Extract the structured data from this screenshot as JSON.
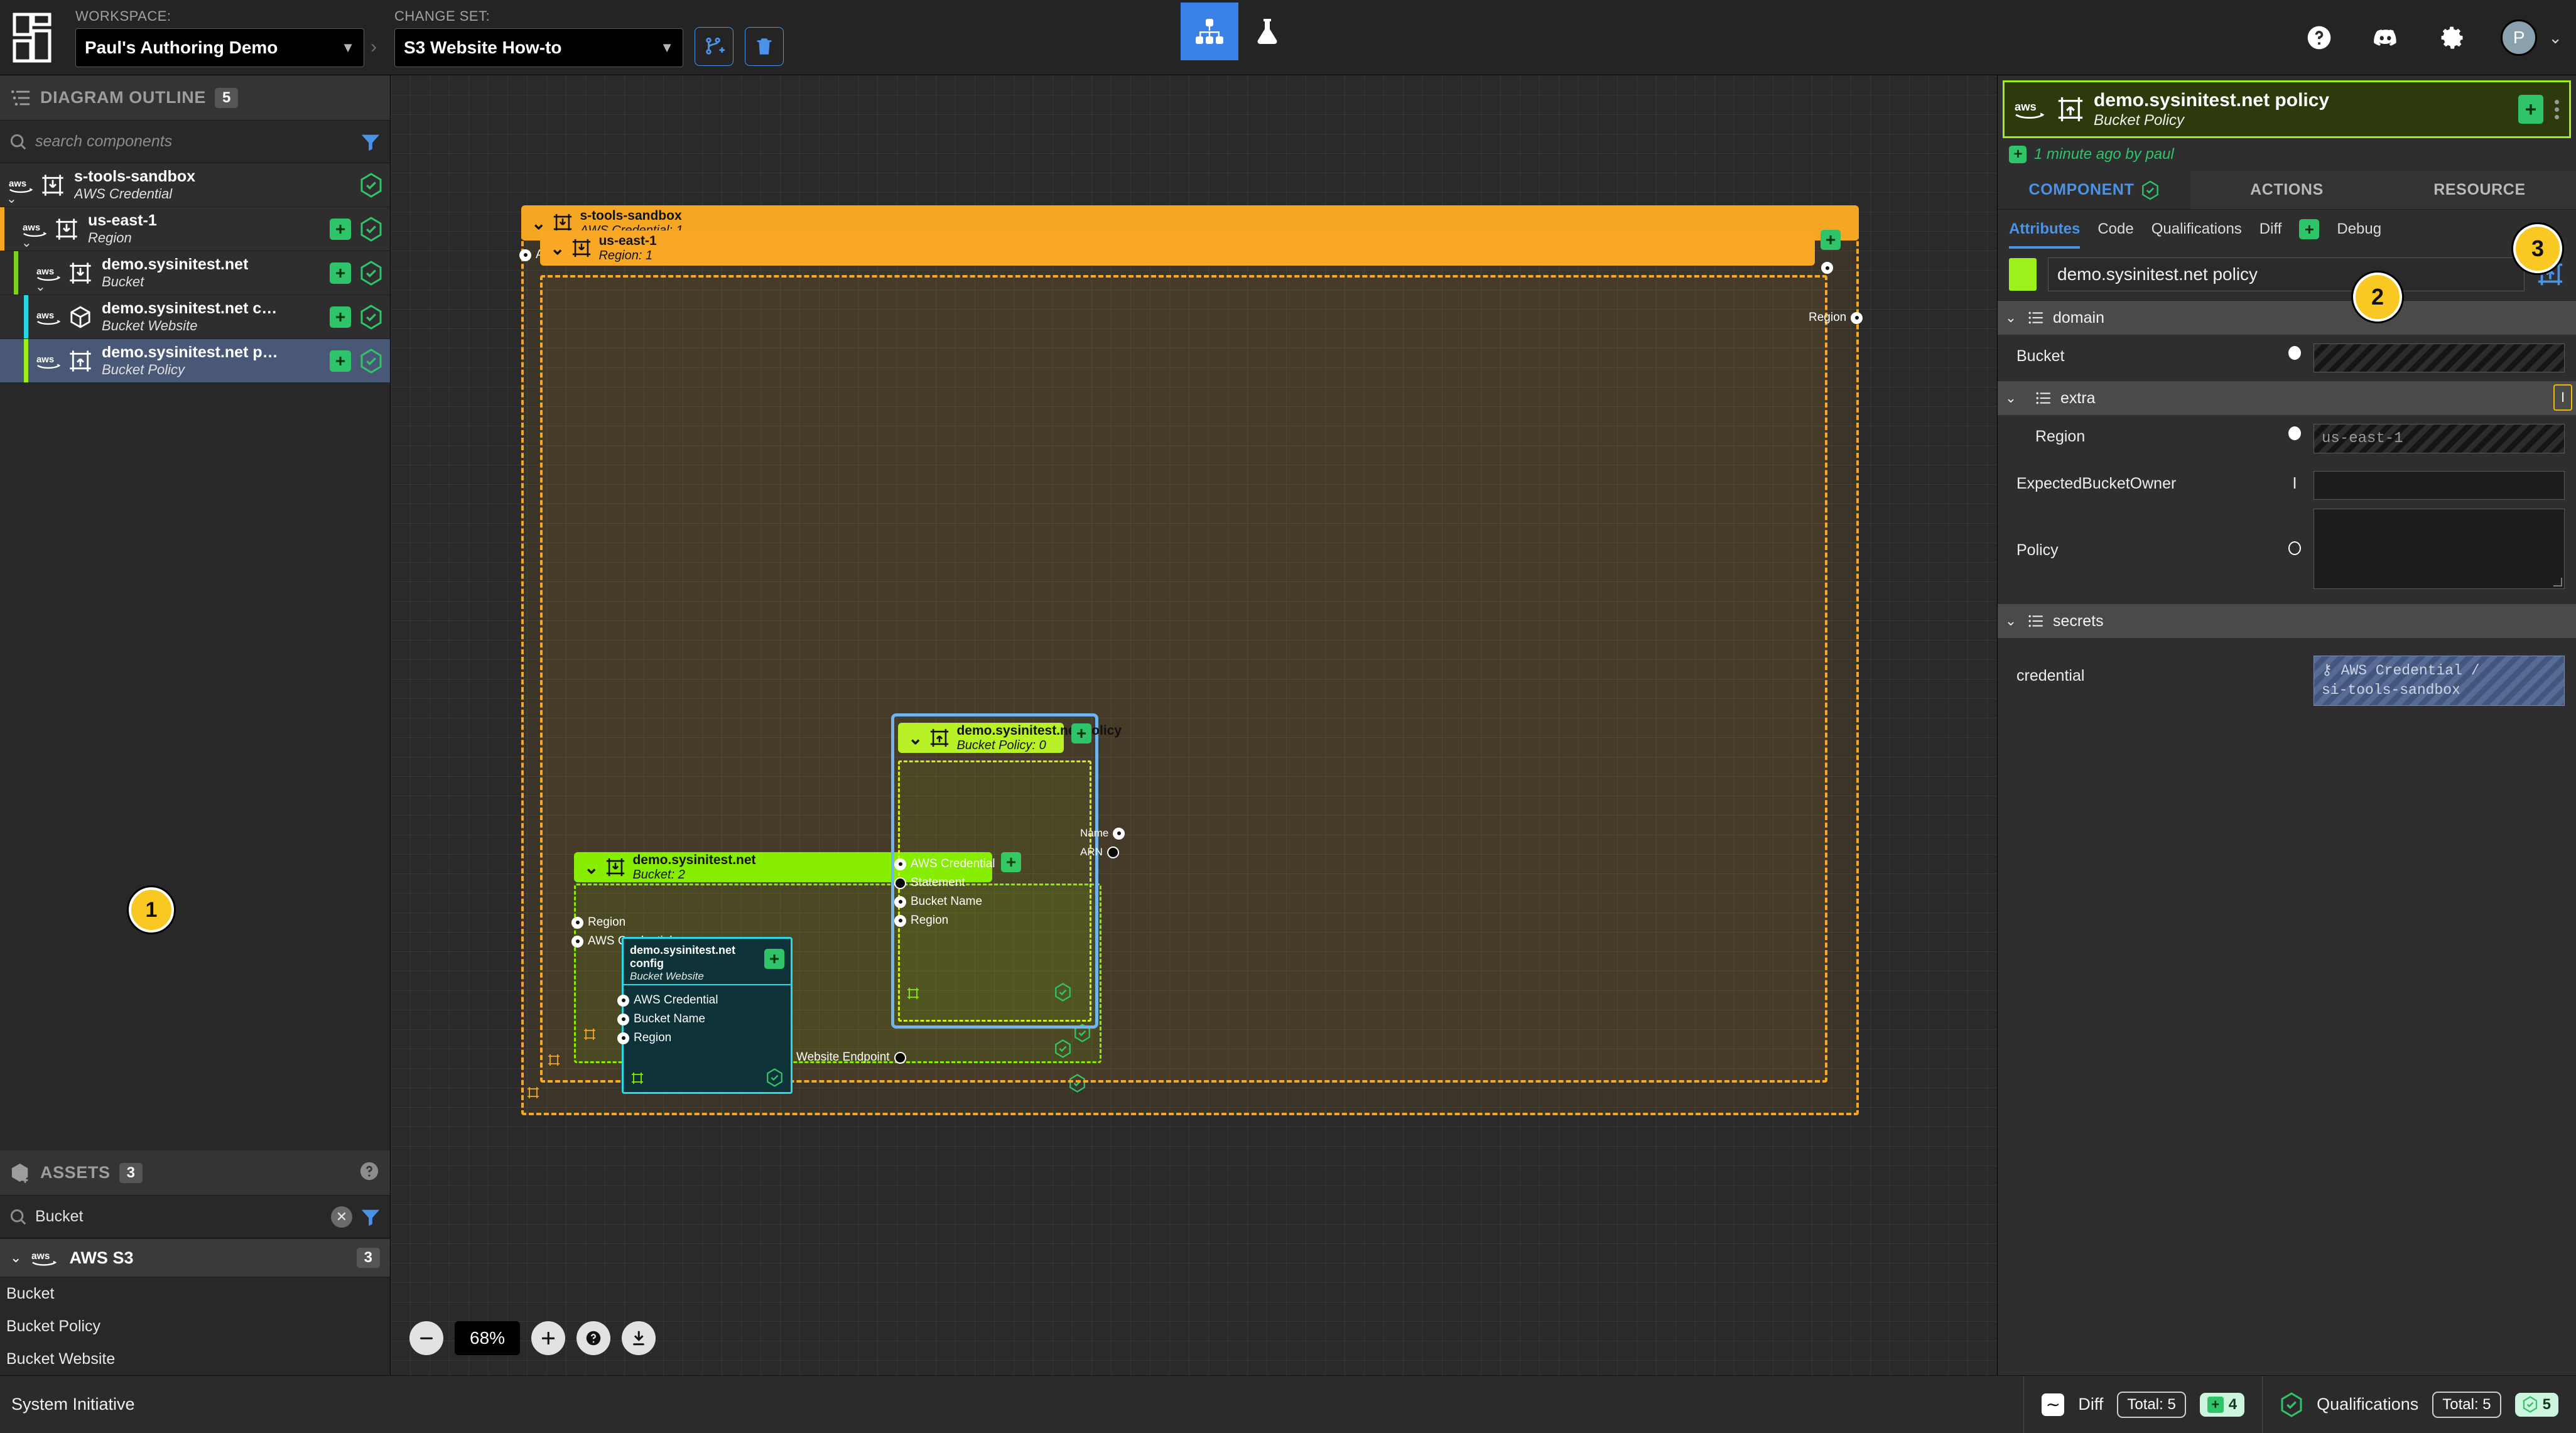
{
  "topbar": {
    "workspace_label": "WORKSPACE:",
    "workspace_value": "Paul's Authoring Demo",
    "changeset_label": "CHANGE SET:",
    "changeset_value": "S3 Website How-to",
    "create_changeset_icon": "branch-plus-icon",
    "delete_changeset_icon": "trash-icon",
    "tool_model": "diagram-tool",
    "tool_lab": "lab-flask-tool",
    "help_icon": "help-circle-icon",
    "discord_icon": "discord-icon",
    "settings_icon": "gear-icon",
    "avatar_initial": "P"
  },
  "outline": {
    "title": "DIAGRAM OUTLINE",
    "count": "5",
    "search_placeholder": "search components",
    "search_value": "",
    "items": [
      {
        "name": "s-tools-sandbox",
        "type": "AWS Credential",
        "indent": 0,
        "bar": "",
        "plus": false,
        "qualified": true,
        "selected": false,
        "icon": "aws-frame-down-icon"
      },
      {
        "name": "us-east-1",
        "type": "Region",
        "indent": 1,
        "bar": "#f5a623",
        "plus": true,
        "qualified": true,
        "selected": false,
        "icon": "aws-frame-down-icon"
      },
      {
        "name": "demo.sysinitest.net",
        "type": "Bucket",
        "indent": 2,
        "bar": "#7ed321",
        "plus": true,
        "qualified": true,
        "selected": false,
        "icon": "aws-frame-down-icon"
      },
      {
        "name": "demo.sysinitest.net c…",
        "type": "Bucket Website",
        "indent": 3,
        "bar": "#27d7e5",
        "plus": true,
        "qualified": true,
        "selected": false,
        "icon": "aws-cube-icon"
      },
      {
        "name": "demo.sysinitest.net p…",
        "type": "Bucket Policy",
        "indent": 3,
        "bar": "#9ef01a",
        "plus": true,
        "qualified": true,
        "selected": true,
        "icon": "aws-frame-up-icon"
      }
    ]
  },
  "assets": {
    "title": "ASSETS",
    "count": "3",
    "help_icon": "help-circle-icon",
    "search_value": "Bucket",
    "clear_icon": "clear-x-icon",
    "filter_icon": "filter-icon",
    "group_name": "AWS S3",
    "group_count": "3",
    "items": [
      "Bucket",
      "Bucket Policy",
      "Bucket Website"
    ]
  },
  "callouts": [
    {
      "num": "1",
      "target": "assets-item-bucket-policy"
    },
    {
      "num": "2",
      "target": "component-name-input"
    },
    {
      "num": "3",
      "target": "component-subtabs"
    }
  ],
  "canvas": {
    "zoom_level": "68%",
    "zoom_out_icon": "minus-icon",
    "zoom_in_icon": "plus-icon",
    "help_icon": "help-circle-icon",
    "download_icon": "download-icon",
    "frames": [
      {
        "id": "credential-frame",
        "name": "s-tools-sandbox",
        "subtitle": "AWS Credential: 1",
        "color": "#f5a623",
        "sockets_left": [
          {
            "label": "AWS Credential",
            "filled": true
          }
        ],
        "sockets_right": []
      },
      {
        "id": "region-frame",
        "name": "us-east-1",
        "subtitle": "Region: 1",
        "color": "#f9a825",
        "sockets_left": [],
        "sockets_right": [
          {
            "label": "Region",
            "filled": true
          }
        ]
      },
      {
        "id": "bucket-frame",
        "name": "demo.sysinitest.net",
        "subtitle": "Bucket: 2",
        "color": "#88ee00",
        "sockets_left": [
          {
            "label": "Region",
            "filled": true
          },
          {
            "label": "AWS Credential",
            "filled": true
          }
        ],
        "sockets_right": []
      },
      {
        "id": "policy-frame",
        "name": "demo.sysinitest.net policy",
        "subtitle": "Bucket Policy: 0",
        "color": "#b8f125",
        "selected": true,
        "sockets_left": [
          {
            "label": "AWS Credential",
            "filled": true
          },
          {
            "label": "Statement",
            "filled": false
          },
          {
            "label": "Bucket Name",
            "filled": true
          },
          {
            "label": "Region",
            "filled": true
          }
        ],
        "sockets_right": [
          {
            "label": "Name",
            "filled": true
          },
          {
            "label": "ARN",
            "filled": false
          }
        ]
      }
    ],
    "node": {
      "id": "website-node",
      "name": "demo.sysinitest.net config",
      "subtitle": "Bucket Website",
      "color": "#2ad9e8",
      "sockets_left": [
        {
          "label": "AWS Credential",
          "filled": true
        },
        {
          "label": "Bucket Name",
          "filled": true
        },
        {
          "label": "Region",
          "filled": true
        }
      ],
      "sockets_right": [
        {
          "label": "Website Endpoint",
          "filled": false
        }
      ]
    }
  },
  "rightpanel": {
    "header_name": "demo.sysinitest.net policy",
    "header_type": "Bucket Policy",
    "add_icon": "plus-icon",
    "menu_icon": "kebab-menu-icon",
    "meta_text": "1 minute ago by paul",
    "tabs": [
      {
        "label": "COMPONENT",
        "active": true,
        "badge": "qualification-check-icon"
      },
      {
        "label": "ACTIONS",
        "active": false
      },
      {
        "label": "RESOURCE",
        "active": false
      }
    ],
    "subtabs": [
      {
        "label": "Attributes",
        "active": true
      },
      {
        "label": "Code",
        "active": false
      },
      {
        "label": "Qualifications",
        "active": false
      },
      {
        "label": "Diff",
        "active": false,
        "badge": "+"
      },
      {
        "label": "Debug",
        "active": false
      }
    ],
    "component_color": "#9ef01a",
    "component_name": "demo.sysinitest.net policy",
    "frame_icon": "aws-frame-up-icon",
    "sections": [
      {
        "name": "domain",
        "level": 1,
        "rows": [
          {
            "label": "Bucket",
            "marker": "socket-filled",
            "value": "",
            "style": "hatched",
            "indent": 0
          }
        ]
      },
      {
        "name": "extra",
        "level": 2,
        "cursor_badge": true,
        "rows": [
          {
            "label": "Region",
            "marker": "socket-filled",
            "value": "us-east-1",
            "style": "hatched",
            "indent": 1
          },
          {
            "label": "ExpectedBucketOwner",
            "marker": "text-cursor",
            "value": "",
            "style": "plain",
            "indent": 0
          },
          {
            "label": "Policy",
            "marker": "socket-hollow",
            "value": "",
            "style": "tall",
            "indent": 0
          }
        ]
      },
      {
        "name": "secrets",
        "level": 1,
        "rows": [
          {
            "label": "credential",
            "marker": "none",
            "value": "AWS Credential /\nsi-tools-sandbox",
            "style": "credential",
            "indent": 0
          }
        ]
      }
    ]
  },
  "statusbar": {
    "brand": "System Initiative",
    "diff_label": "Diff",
    "diff_icon": "diff-wave-icon",
    "diff_total": "Total: 5",
    "diff_added": "4",
    "qual_label": "Qualifications",
    "qual_icon": "qualification-check-icon",
    "qual_total": "Total: 5",
    "qual_passed": "5"
  }
}
